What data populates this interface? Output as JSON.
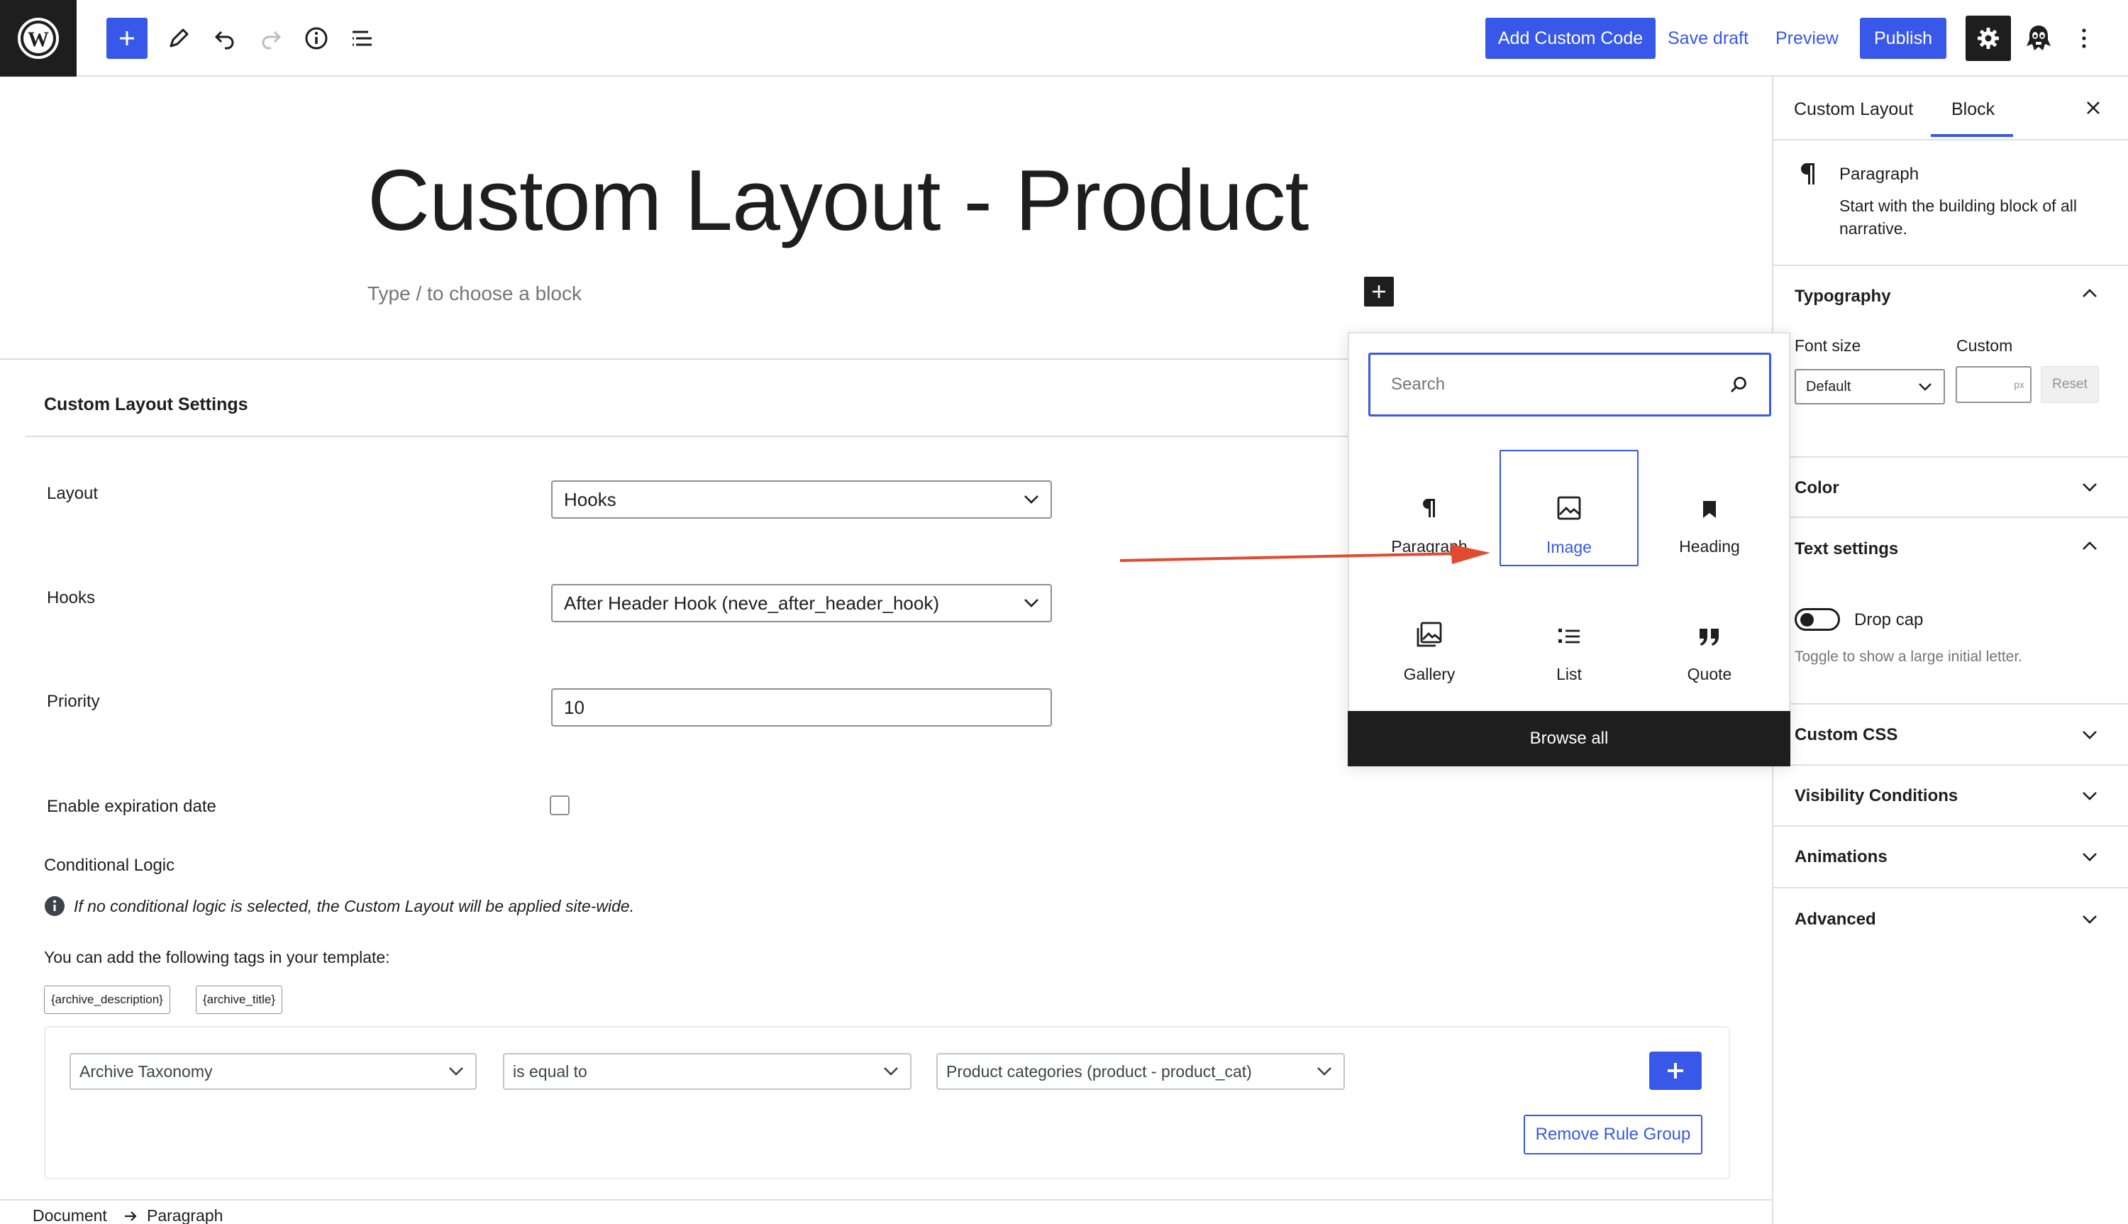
{
  "toolbar": {
    "add_custom_code": "Add Custom Code",
    "save_draft": "Save draft",
    "preview": "Preview",
    "publish": "Publish"
  },
  "editor": {
    "title": "Custom Layout - Product",
    "placeholder": "Type / to choose a block"
  },
  "metabox": {
    "title": "Custom Layout Settings",
    "fields": {
      "layout_label": "Layout",
      "layout_value": "Hooks",
      "hooks_label": "Hooks",
      "hooks_value": "After Header Hook (neve_after_header_hook)",
      "priority_label": "Priority",
      "priority_value": "10",
      "expiration_label": "Enable expiration date",
      "expiration_checked": false
    },
    "conditional": {
      "title": "Conditional Logic",
      "note": "If no conditional logic is selected, the Custom Layout will be applied site-wide.",
      "tags_intro": "You can add the following tags in your template:",
      "tags": [
        "{archive_description}",
        "{archive_title}"
      ],
      "rule": {
        "subject": "Archive Taxonomy",
        "operator": "is equal to",
        "value": "Product categories (product - product_cat)"
      },
      "remove_group": "Remove Rule Group"
    }
  },
  "breadcrumb": {
    "items": [
      "Document",
      "Paragraph"
    ]
  },
  "inserter": {
    "search_placeholder": "Search",
    "blocks": [
      {
        "label": "Paragraph",
        "icon": "paragraph-icon"
      },
      {
        "label": "Image",
        "icon": "image-icon",
        "selected": true
      },
      {
        "label": "Heading",
        "icon": "heading-bookmark-icon"
      },
      {
        "label": "Gallery",
        "icon": "gallery-icon"
      },
      {
        "label": "List",
        "icon": "list-icon"
      },
      {
        "label": "Quote",
        "icon": "quote-icon"
      }
    ],
    "browse_all": "Browse all"
  },
  "sidebar": {
    "tabs": [
      "Custom Layout",
      "Block"
    ],
    "active_tab": "Block",
    "block": {
      "name": "Paragraph",
      "description": "Start with the building block of all narrative."
    },
    "typography": {
      "title": "Typography",
      "font_size_label": "Font size",
      "custom_label": "Custom",
      "font_size_value": "Default",
      "unit": "px",
      "reset": "Reset"
    },
    "color": {
      "title": "Color"
    },
    "text_settings": {
      "title": "Text settings",
      "drop_cap_label": "Drop cap",
      "drop_cap_help": "Toggle to show a large initial letter.",
      "drop_cap_on": false
    },
    "panels": [
      "Custom CSS",
      "Visibility Conditions",
      "Animations",
      "Advanced"
    ]
  },
  "colors": {
    "accent": "#3858e9",
    "dark": "#1e1e1e",
    "annotation_arrow": "#e24a2f"
  }
}
